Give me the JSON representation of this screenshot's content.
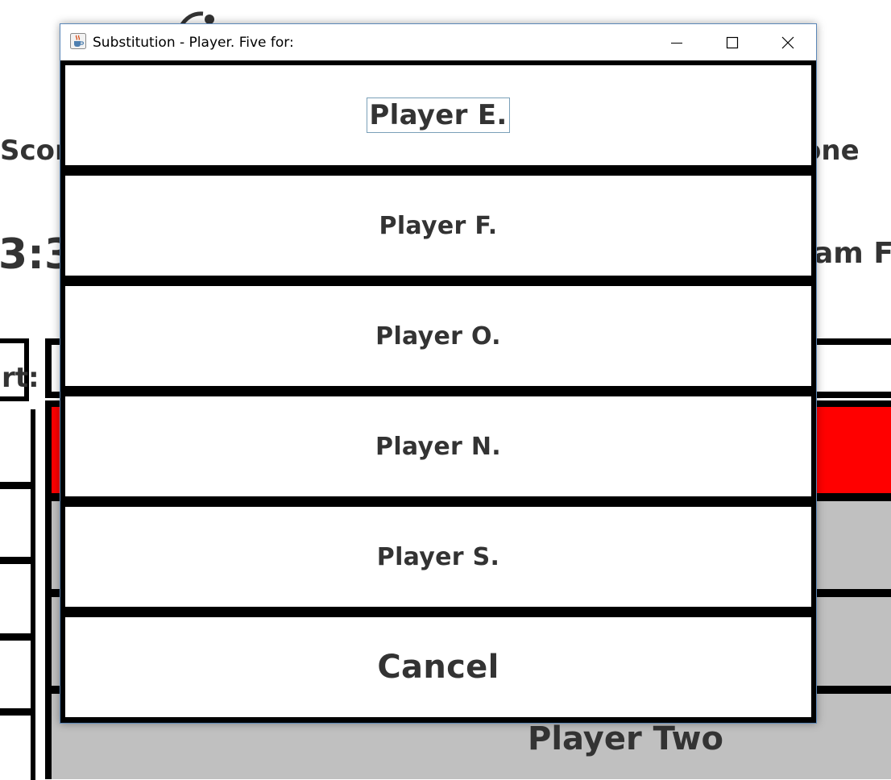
{
  "background": {
    "score_label": "Scor",
    "done_label": "one",
    "clock": "3:3",
    "team_label": "am F",
    "start_label": "rt:",
    "player_two_label": "Player Two",
    "highlight_color": "#ff0000",
    "panel_color": "#c0c0c0"
  },
  "dialog": {
    "title": "Substitution - Player. Five for:",
    "app_icon": "java-cup-icon",
    "controls": {
      "minimize": "minimize-icon",
      "maximize": "maximize-icon",
      "close": "close-icon"
    },
    "options": [
      {
        "label": "Player E.",
        "focused": true
      },
      {
        "label": "Player F.",
        "focused": false
      },
      {
        "label": "Player O.",
        "focused": false
      },
      {
        "label": "Player N.",
        "focused": false
      },
      {
        "label": "Player S.",
        "focused": false
      }
    ],
    "cancel_label": "Cancel"
  }
}
